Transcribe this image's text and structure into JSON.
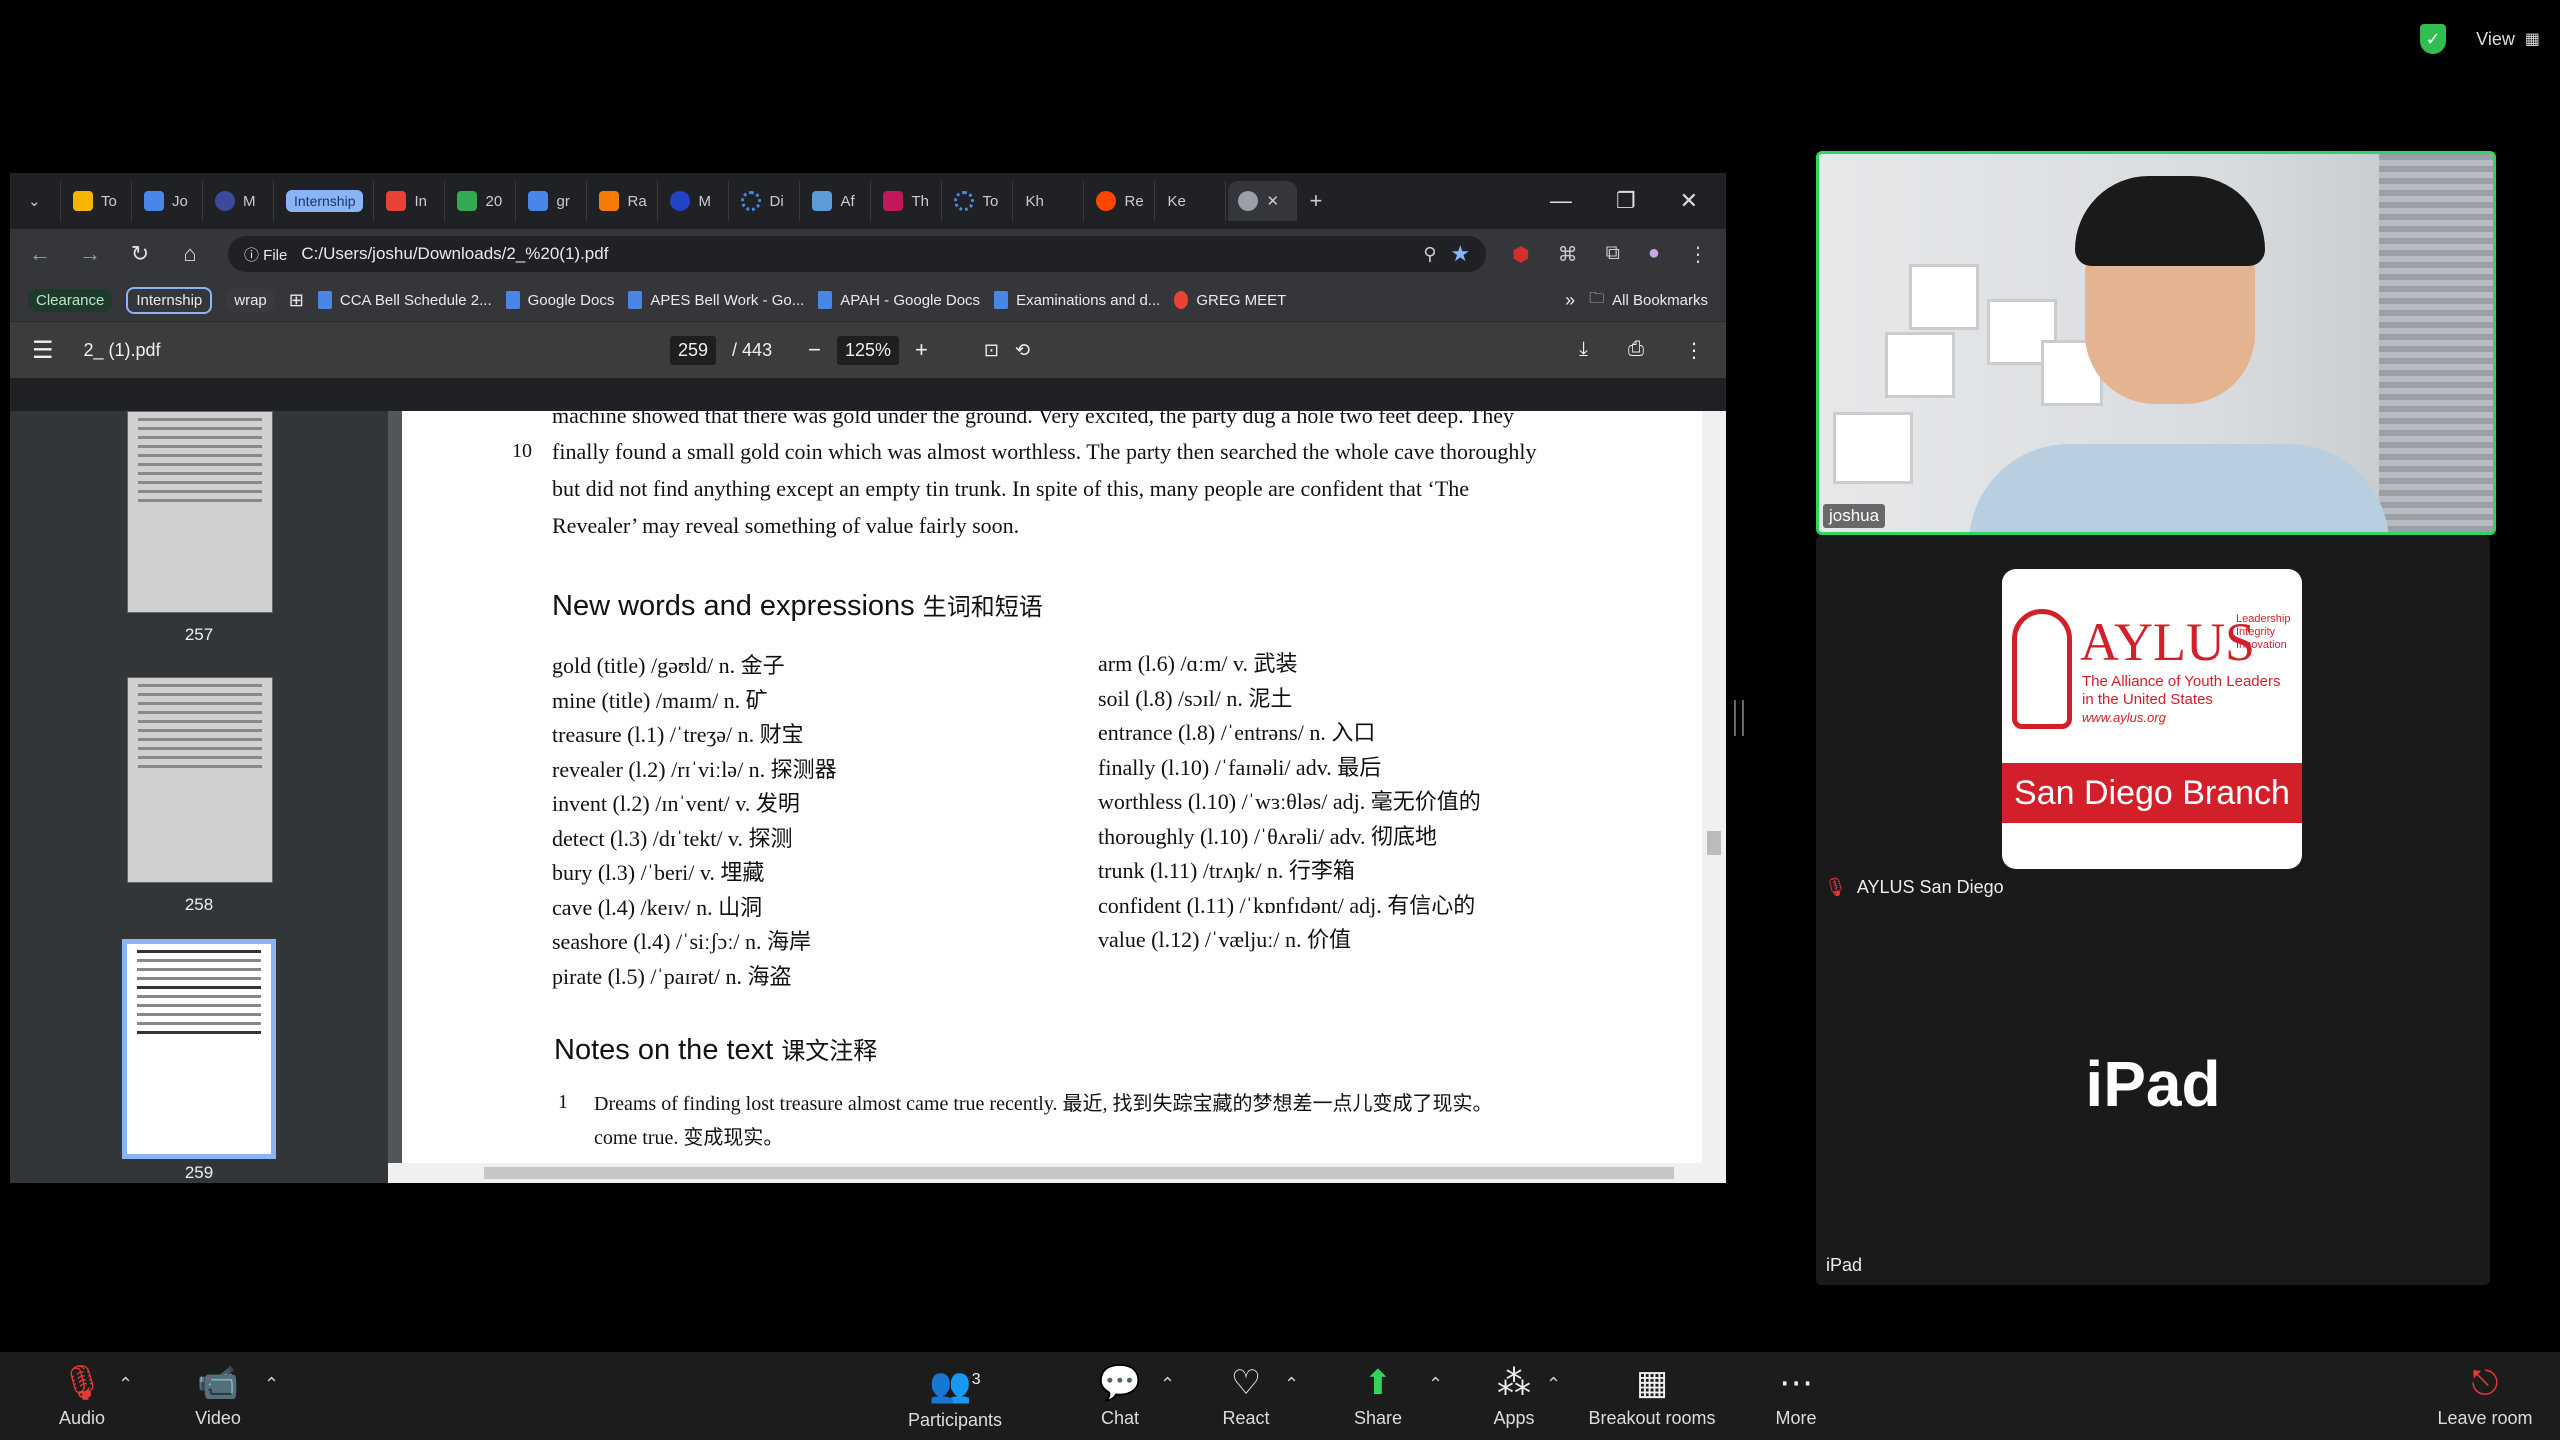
{
  "zoom": {
    "view_label": "View",
    "participant_count": "3",
    "toolbar": {
      "audio": "Audio",
      "video": "Video",
      "participants": "Participants",
      "chat": "Chat",
      "react": "React",
      "share": "Share",
      "apps": "Apps",
      "breakout": "Breakout rooms",
      "more": "More",
      "leave": "Leave room"
    },
    "tiles": {
      "cam_name": "joshua",
      "aylus_name": "AYLUS San Diego",
      "ipad_big": "iPad",
      "ipad_small": "iPad"
    },
    "aylus_logo": {
      "wordmark": "AYLUS",
      "tag1": "Leadership",
      "tag2": "Integrity",
      "tag3": "Innovation",
      "full_name1": "The Alliance of Youth Leaders",
      "full_name2": "in the United States",
      "url": "www.aylus.org",
      "branch": "San Diego Branch"
    }
  },
  "browser": {
    "tabs": [
      "To",
      "Jo",
      "M",
      "Internship",
      "In",
      "20",
      "gr",
      "Ra",
      "M",
      "Di",
      "Af",
      "Th",
      "To",
      "Kh",
      "Re",
      "Ke",
      ""
    ],
    "address": "C:/Users/joshu/Downloads/2_%20(1).pdf",
    "address_chip": "File",
    "bookmarks": {
      "tag1": "Clearance",
      "tag2": "Internship",
      "tag3": "wrap",
      "items": [
        "CCA Bell Schedule 2...",
        "Google Docs",
        "APES Bell Work - Go...",
        "APAH - Google Docs",
        "Examinations and d...",
        "GREG MEET"
      ],
      "all": "All Bookmarks"
    }
  },
  "pdf": {
    "filename": "2_ (1).pdf",
    "page_current": "259",
    "page_total": "/ 443",
    "zoom": "125%",
    "thumbs": [
      "257",
      "258",
      "259"
    ],
    "body_lines": [
      "machine showed that there was gold under the ground. Very excited, the party dug a hole two feet deep. They",
      "finally found a small gold coin which was almost worthless. The party then searched the whole cave thoroughly",
      "but did not find anything except an empty tin trunk. In spite of this, many people are confident that ‘The",
      "Revealer’ may reveal something of value fairly soon."
    ],
    "line_number": "10",
    "words_heading": "New words and expressions",
    "words_heading_cn": "生词和短语",
    "vocab_left": [
      "gold (title) /gəʊld/ n. 金子",
      "mine (title) /maɪm/ n. 矿",
      "treasure (l.1) /ˈtreʒə/ n. 财宝",
      "revealer (l.2) /rɪˈviːlə/ n. 探测器",
      "invent (l.2) /ɪnˈvent/ v. 发明",
      "detect (l.3) /dɪˈtekt/ v. 探测",
      "bury (l.3) /ˈberi/ v. 埋藏",
      "cave (l.4) /keɪv/ n. 山洞",
      "seashore (l.4) /ˈsiːʃɔː/ n. 海岸",
      "pirate (l.5) /ˈpaɪrət/ n. 海盗"
    ],
    "vocab_right": [
      "arm (l.6) /ɑːm/ v. 武装",
      "soil (l.8) /sɔɪl/ n. 泥土",
      "entrance (l.8) /ˈentrəns/ n. 入口",
      "finally (l.10) /ˈfaɪnəli/ adv. 最后",
      "worthless (l.10) /ˈwɜːθləs/ adj. 毫无价值的",
      "thoroughly (l.10) /ˈθʌrəli/ adv. 彻底地",
      "trunk (l.11) /trʌŋk/ n. 行李箱",
      "confident (l.11) /ˈkɒnfɪdənt/ adj. 有信心的",
      "value (l.12) /ˈvæljuː/ n. 价值"
    ],
    "notes_heading": "Notes on the text",
    "notes_heading_cn": "课文注释",
    "note_num": "1",
    "note_line1": "Dreams of finding lost treasure almost came true recently. 最近, 找到失踪宝藏的梦想差一点儿变成了现实。",
    "note_line2": "come true. 变成现实。"
  }
}
